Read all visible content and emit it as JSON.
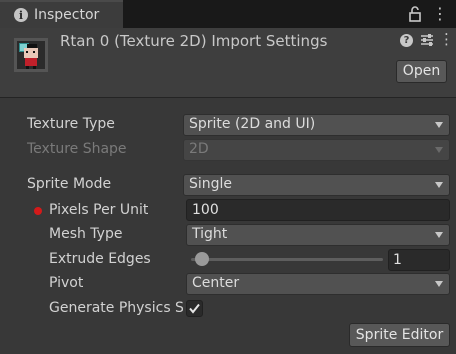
{
  "tab": {
    "label": "Inspector",
    "icon": "info-icon"
  },
  "header": {
    "title": "Rtan 0 (Texture 2D) Import Settings",
    "open_label": "Open"
  },
  "fields": {
    "texture_type": {
      "label": "Texture Type",
      "value": "Sprite (2D and UI)"
    },
    "texture_shape": {
      "label": "Texture Shape",
      "value": "2D"
    },
    "sprite_mode": {
      "label": "Sprite Mode",
      "value": "Single"
    },
    "pixels_per_unit": {
      "label": "Pixels Per Unit",
      "value": "100"
    },
    "mesh_type": {
      "label": "Mesh Type",
      "value": "Tight"
    },
    "extrude_edges": {
      "label": "Extrude Edges",
      "value": "1",
      "slider_fraction": 0.03
    },
    "pivot": {
      "label": "Pivot",
      "value": "Center"
    },
    "generate_physics_shape": {
      "label": "Generate Physics Shape",
      "checked": true
    }
  },
  "sprite_editor_label": "Sprite Editor",
  "colors": {
    "background": "#383838",
    "override_indicator": "#d41a1a",
    "button": "#585858"
  }
}
